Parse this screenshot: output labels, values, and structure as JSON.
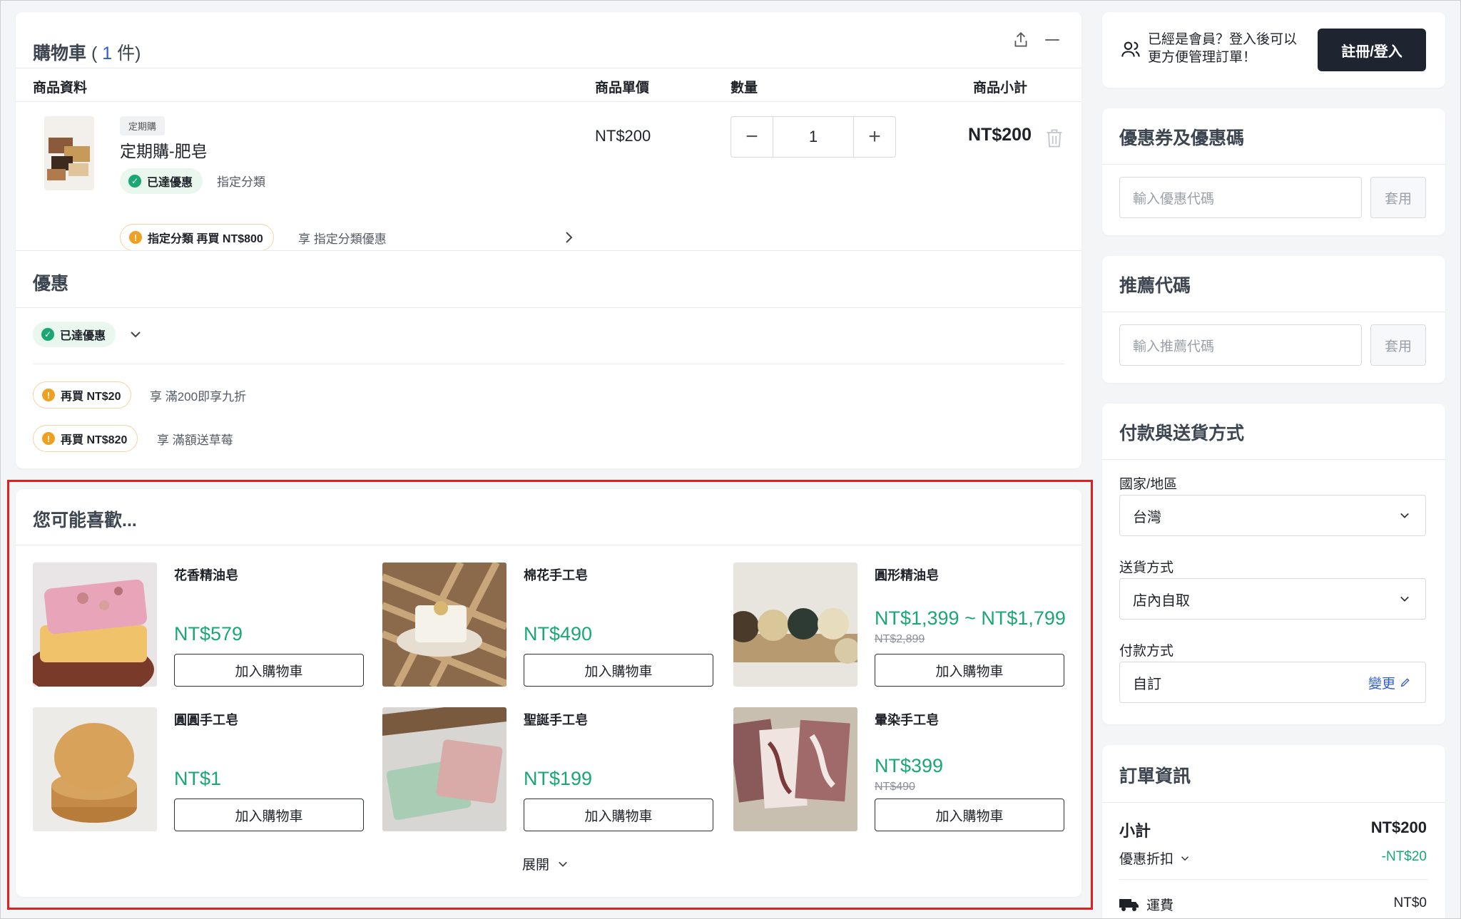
{
  "cart": {
    "title": "購物車",
    "open_paren": "(",
    "count": "1",
    "count_unit": "件)",
    "headers": {
      "info": "商品資料",
      "unit_price": "商品單價",
      "qty": "數量",
      "subtotal": "商品小計"
    },
    "item": {
      "tag": "定期購",
      "name": "定期購-肥皂",
      "discount_badge": "已達優惠",
      "category_text": "指定分類",
      "promo_badge": "指定分類 再買 NT$800",
      "promo_text": "享 指定分類優惠",
      "unit_price": "NT$200",
      "quantity": "1",
      "subtotal": "NT$200"
    }
  },
  "offers": {
    "title": "優惠",
    "achieved_badge": "已達優惠",
    "rows": [
      {
        "badge": "再買 NT$20",
        "text": "享 滿200即享九折"
      },
      {
        "badge": "再買 NT$820",
        "text": "享 滿額送草莓"
      }
    ]
  },
  "recommend": {
    "title": "您可能喜歡...",
    "add_label": "加入購物車",
    "expand_label": "展開",
    "items": [
      {
        "name": "花香精油皂",
        "price": "NT$579",
        "old_price": ""
      },
      {
        "name": "棉花手工皂",
        "price": "NT$490",
        "old_price": ""
      },
      {
        "name": "圓形精油皂",
        "price": "NT$1,399 ~ NT$1,799",
        "old_price": "NT$2,899"
      },
      {
        "name": "圓圓手工皂",
        "price": "NT$1",
        "old_price": ""
      },
      {
        "name": "聖誕手工皂",
        "price": "NT$199",
        "old_price": ""
      },
      {
        "name": "暈染手工皂",
        "price": "NT$399",
        "old_price": "NT$490"
      }
    ]
  },
  "sidebar": {
    "login": {
      "text_line1": "已經是會員？登入後可以",
      "text_line2": "更方便管理訂單！",
      "button": "註冊/登入"
    },
    "coupon": {
      "title": "優惠券及優惠碼",
      "placeholder": "輸入優惠代碼",
      "apply": "套用"
    },
    "referral": {
      "title": "推薦代碼",
      "placeholder": "輸入推薦代碼",
      "apply": "套用"
    },
    "payment": {
      "title": "付款與送貨方式",
      "country_label": "國家/地區",
      "country": "台灣",
      "shipping_label": "送貨方式",
      "shipping": "店內自取",
      "pay_label": "付款方式",
      "pay": "自訂",
      "change": "變更"
    },
    "summary": {
      "title": "訂單資訊",
      "subtotal_label": "小計",
      "subtotal": "NT$200",
      "discount_label": "優惠折扣",
      "discount": "-NT$20",
      "shipping_label": "運費",
      "shipping": "NT$0"
    }
  },
  "colors": {
    "accent_green": "#1aa774",
    "warn_orange": "#f0a020",
    "link_blue": "#2f5bd8",
    "highlight_red": "#e02020"
  }
}
